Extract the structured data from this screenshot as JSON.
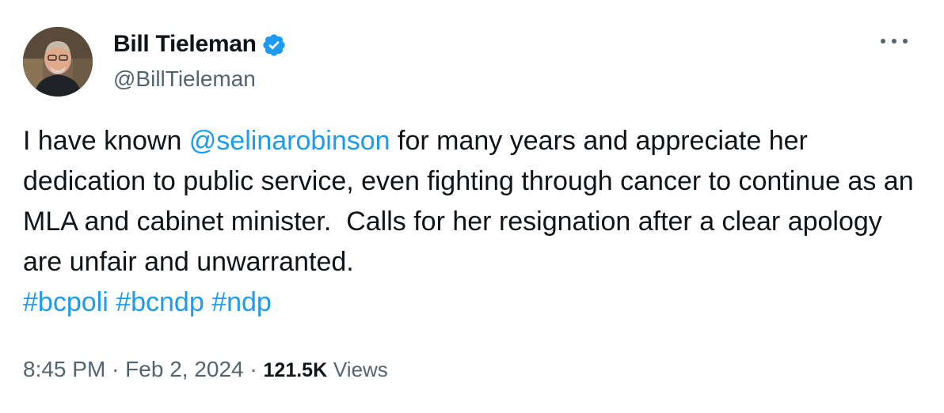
{
  "author": {
    "display_name": "Bill Tieleman",
    "handle": "@BillTieleman",
    "verified_icon": "verified-badge-icon",
    "avatar": "avatar-photo"
  },
  "menu": {
    "icon": "more-options-icon"
  },
  "tweet": {
    "text_before": "I have known ",
    "mention": "@selinarobinson",
    "text_after": " for many years and appreciate her dedication to public service, even fighting through cancer to continue as an MLA and cabinet minister.  Calls for her resignation after a clear apology are unfair and unwarranted.",
    "hashtags": [
      "#bcpoli",
      "#bcndp",
      "#ndp"
    ]
  },
  "meta": {
    "time": "8:45 PM",
    "separator": "·",
    "date": "Feb 2, 2024",
    "views_count": "121.5K",
    "views_label": "Views"
  },
  "colors": {
    "link": "#1d9bf0",
    "text": "#0f1419",
    "secondary": "#536471",
    "verified": "#1d9bf0"
  }
}
